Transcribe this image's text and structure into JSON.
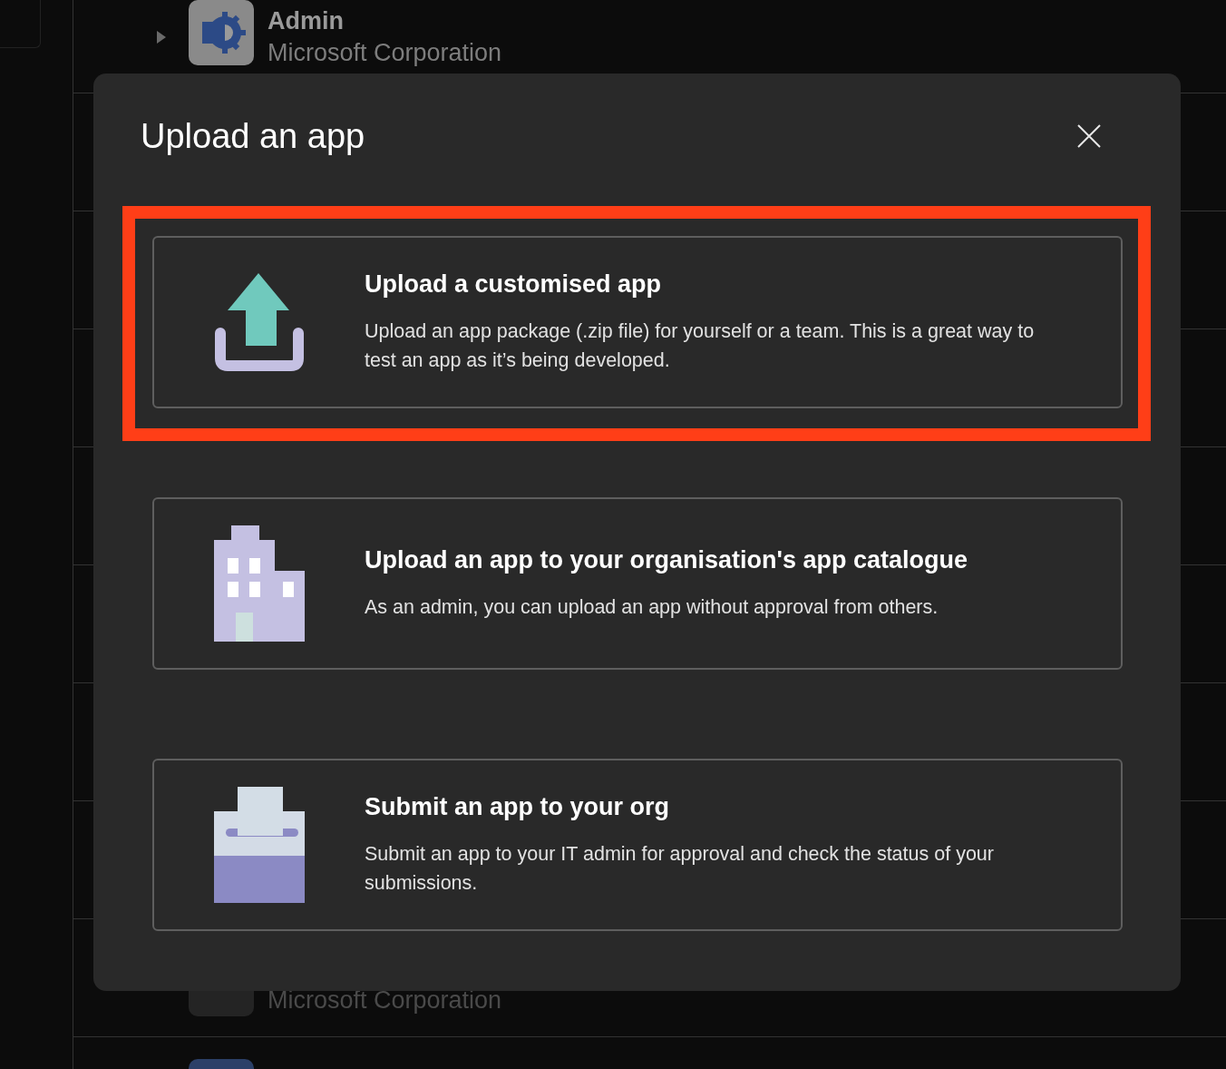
{
  "background_list": {
    "rows": [
      {
        "title": "Admin",
        "publisher": "Microsoft Corporation",
        "kind": "admin"
      },
      {
        "publisher": "Microsoft Corporation",
        "kind": "tile"
      }
    ]
  },
  "dialog": {
    "title": "Upload an app",
    "options": [
      {
        "kind": "upload",
        "title": "Upload a customised app",
        "description": "Upload an app package (.zip file) for yourself or a team. This is a great way to test an app as it’s being developed.",
        "highlighted": true
      },
      {
        "kind": "building",
        "title": "Upload an app to your organisation's app catalogue",
        "description": "As an admin, you can upload an app without approval from others.",
        "highlighted": false
      },
      {
        "kind": "submit",
        "title": "Submit an app to your org",
        "description": "Submit an app to your IT admin for approval and check the status of your submissions.",
        "highlighted": false
      }
    ]
  }
}
